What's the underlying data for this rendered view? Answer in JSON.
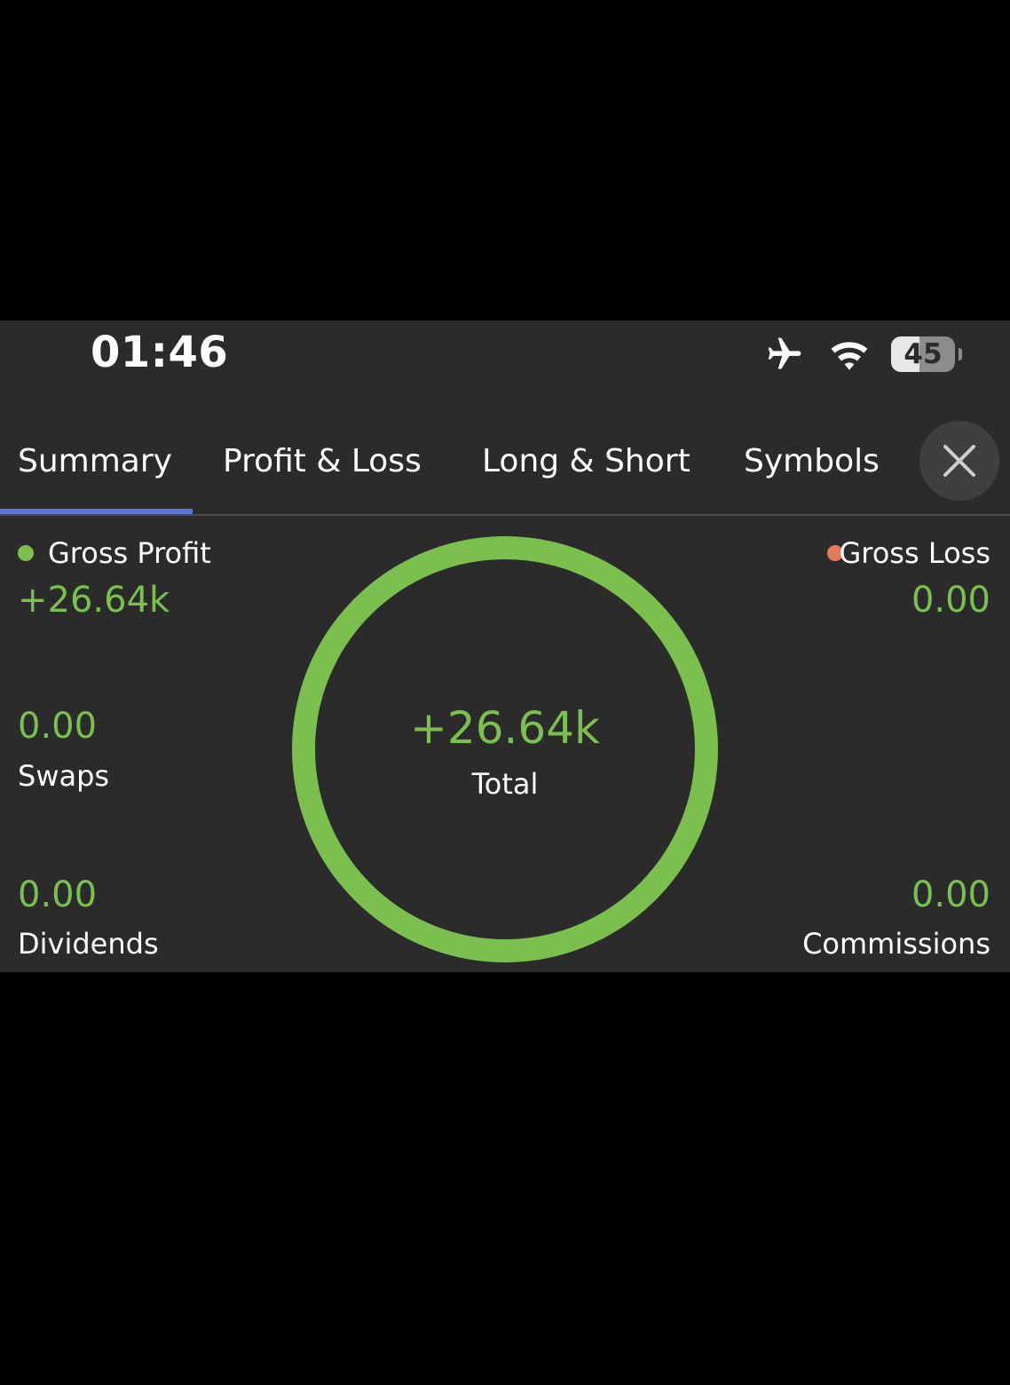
{
  "status_bar": {
    "time": "01:46",
    "airplane_icon": "airplane-icon",
    "wifi_icon": "wifi-icon",
    "battery_level": "45",
    "battery_fraction": 0.45
  },
  "tabs": [
    {
      "label": "Summary",
      "active": true
    },
    {
      "label": "Profit & Loss",
      "active": false
    },
    {
      "label": "Long & Short",
      "active": false
    },
    {
      "label": "Symbols",
      "active": false
    }
  ],
  "close_icon": "close-icon",
  "summary": {
    "gross_profit": {
      "label": "Gross Profit",
      "value": "+26.64k",
      "dot_color": "#7bbf4f"
    },
    "gross_loss": {
      "label": "Gross Loss",
      "value": "0.00",
      "dot_color": "#e07a5a"
    },
    "swaps": {
      "label": "Swaps",
      "value": "0.00"
    },
    "dividends": {
      "label": "Dividends",
      "value": "0.00"
    },
    "commissions": {
      "label": "Commissions",
      "value": "0.00"
    },
    "total": {
      "label": "Total",
      "value": "+26.64k"
    }
  },
  "colors": {
    "accent_positive": "#7bbf4f",
    "tab_underline": "#5b74d6",
    "background": "#2b2b2c"
  }
}
